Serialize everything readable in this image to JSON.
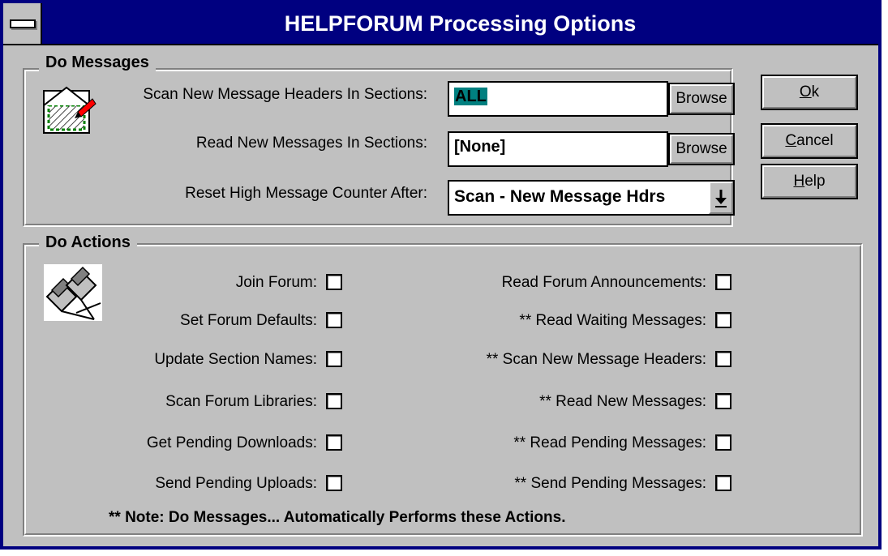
{
  "window": {
    "title": "HELPFORUM Processing Options"
  },
  "do_messages": {
    "group_title": "Do Messages",
    "scan_label": "Scan New Message Headers In Sections:",
    "scan_value": "ALL",
    "read_label": "Read New Messages In Sections:",
    "read_value": "[None]",
    "reset_label": "Reset High Message Counter After:",
    "reset_value": "Scan - New Message Hdrs",
    "browse_label": "Browse"
  },
  "do_actions": {
    "group_title": "Do Actions",
    "left": [
      {
        "label": "Join Forum:",
        "checked": false
      },
      {
        "label": "Set Forum Defaults:",
        "checked": false
      },
      {
        "label": "Update Section Names:",
        "checked": false
      },
      {
        "label": "Scan Forum Libraries:",
        "checked": false
      },
      {
        "label": "Get Pending Downloads:",
        "checked": false
      },
      {
        "label": "Send Pending Uploads:",
        "checked": false
      }
    ],
    "right": [
      {
        "label": "Read Forum Announcements:",
        "checked": false
      },
      {
        "label": "** Read Waiting Messages:",
        "checked": false
      },
      {
        "label": "** Scan New Message Headers:",
        "checked": false
      },
      {
        "label": "** Read New Messages:",
        "checked": false
      },
      {
        "label": "** Read Pending Messages:",
        "checked": false
      },
      {
        "label": "** Send Pending Messages:",
        "checked": false
      }
    ],
    "note": "** Note: Do Messages...  Automatically Performs these Actions."
  },
  "buttons": {
    "ok": {
      "accel": "O",
      "rest": "k"
    },
    "cancel": {
      "accel": "C",
      "rest": "ancel"
    },
    "help": {
      "accel": "H",
      "rest": "elp"
    }
  },
  "icons": {
    "messages_icon": "envelope-pencil-icon",
    "actions_icon": "computers-network-icon",
    "dropdown_icon": "down-arrow-icon"
  }
}
